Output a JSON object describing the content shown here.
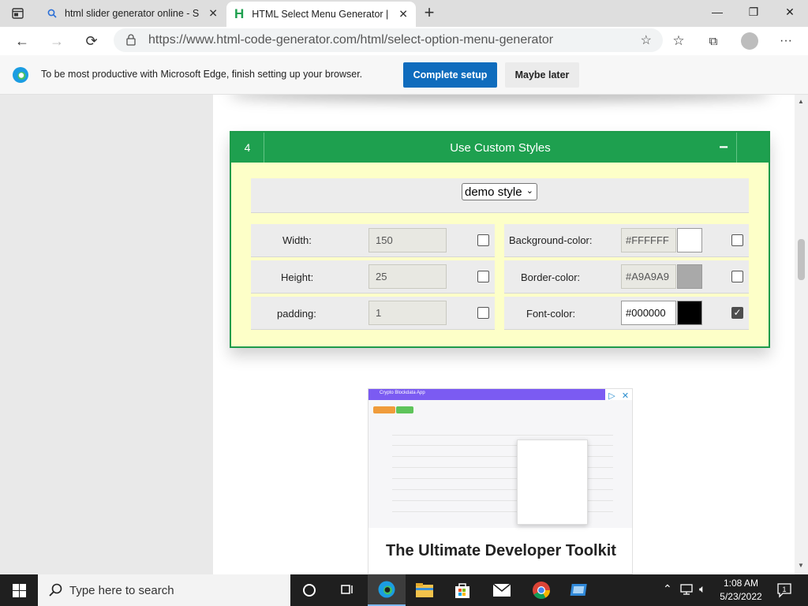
{
  "browser": {
    "tabs": [
      {
        "label": "html slider generator online - Se",
        "icon": "search-icon"
      },
      {
        "label": "HTML Select Menu Generator | S",
        "icon": "h-logo-icon"
      }
    ],
    "url": "https://www.html-code-generator.com/html/select-option-menu-generator",
    "infobar": {
      "message": "To be most productive with Microsoft Edge, finish setting up your browser.",
      "complete_label": "Complete setup",
      "later_label": "Maybe later"
    }
  },
  "panel": {
    "number": "4",
    "title": "Use Custom Styles",
    "toggle": "−",
    "demo_select_value": "demo style",
    "left_rows": [
      {
        "label": "Width:",
        "value": "150",
        "checked": false
      },
      {
        "label": "Height:",
        "value": "25",
        "checked": false
      },
      {
        "label": "padding:",
        "value": "1",
        "checked": false
      }
    ],
    "right_rows": [
      {
        "label": "Background-color:",
        "value": "#FFFFFF",
        "swatch": "#FFFFFF",
        "checked": false,
        "active": false
      },
      {
        "label": "Border-color:",
        "value": "#A9A9A9",
        "swatch": "#A9A9A9",
        "checked": false,
        "active": false
      },
      {
        "label": "Font-color:",
        "value": "#000000",
        "swatch": "#000000",
        "checked": true,
        "active": true
      }
    ]
  },
  "ad": {
    "app_title": "Crypto Blockdata App",
    "headline": "The Ultimate Developer Toolkit"
  },
  "taskbar": {
    "search_placeholder": "Type here to search",
    "time": "1:08 AM",
    "date": "5/23/2022"
  },
  "colors": {
    "accent_green": "#1ea04f",
    "panel_bg": "#fdffc8",
    "edge_blue": "#0f6cbd"
  }
}
